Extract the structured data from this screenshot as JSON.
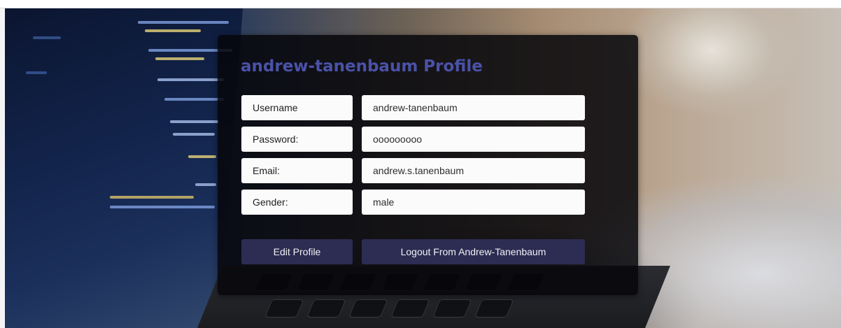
{
  "profile": {
    "title": "andrew-tanenbaum Profile",
    "fields": [
      {
        "label": "Username",
        "value": "andrew-tanenbaum"
      },
      {
        "label": "Password:",
        "value": "ooooooooo"
      },
      {
        "label": "Email:",
        "value": "andrew.s.tanenbaum"
      },
      {
        "label": "Gender:",
        "value": "male"
      }
    ],
    "edit_button_label": "Edit Profile",
    "logout_button_label": "Logout From Andrew-Tanenbaum"
  },
  "colors": {
    "title": "#4a52a8",
    "button_bg": "#2d2c52",
    "card_bg": "#06060a"
  }
}
